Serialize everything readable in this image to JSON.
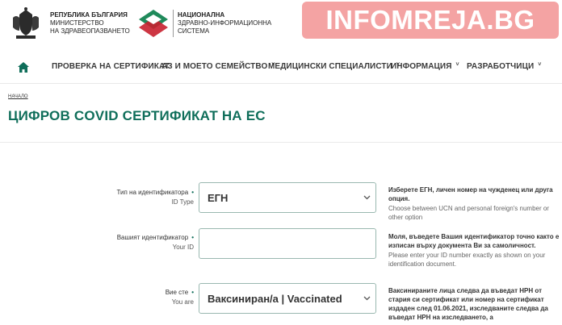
{
  "header": {
    "ministry": [
      "РЕПУБЛИКА БЪЛГАРИЯ",
      "МИНИСТЕРСТВО",
      "НА ЗДРАВЕОПАЗВАНЕТО"
    ],
    "nhis": [
      "НАЦИОНАЛНА",
      "ЗДРАВНО-ИНФОРМАЦИОННА",
      "СИСТЕМА"
    ],
    "watermark": "INFOMREJA.BG"
  },
  "nav": {
    "items": [
      {
        "label": "ПРОВЕРКА НА СЕРТИФИКАТ",
        "dropdown": false
      },
      {
        "label": "АЗ И МОЕТО СЕМЕЙСТВО",
        "dropdown": true
      },
      {
        "label": "МЕДИЦИНСКИ СПЕЦИАЛИСТИ",
        "dropdown": true
      },
      {
        "label": "ИНФОРМАЦИЯ",
        "dropdown": true
      },
      {
        "label": "РАЗРАБОТЧИЦИ",
        "dropdown": true
      }
    ],
    "caret": "˅"
  },
  "breadcrumb": "НАЧАЛО",
  "page_title": "ЦИФРОВ COVID СЕРТИФИКАТ НА ЕС",
  "form": {
    "required_mark": "•",
    "id_type": {
      "label_bg": "Тип на идентификатора",
      "label_en": "ID Type",
      "value": "ЕГН",
      "help_bg": "Изберете ЕГН, личен номер на чужденец или друга опция.",
      "help_en": "Choose between UCN and personal foreign's number or other option"
    },
    "your_id": {
      "label_bg": "Вашият идентификатор",
      "label_en": "Your ID",
      "value": "",
      "help_bg": "Моля, въведете Вашия идентификатор точно както е изписан върху документа Ви за самоличност.",
      "help_en": "Please enter your ID number exactly as shown on your identification document."
    },
    "you_are": {
      "label_bg": "Вие сте",
      "label_en": "You are",
      "value": "Ваксиниран/а | Vaccinated",
      "help_bg": "Ваксинираните лица следва да въведат НРН от стария си сертификат или номер на сертификат издаден след 01.06.2021, изследваните следва да въведат НРН на изследването, а"
    }
  },
  "colors": {
    "accent": "#0f6e5a",
    "watermark_bg": "#f4a3a3"
  }
}
